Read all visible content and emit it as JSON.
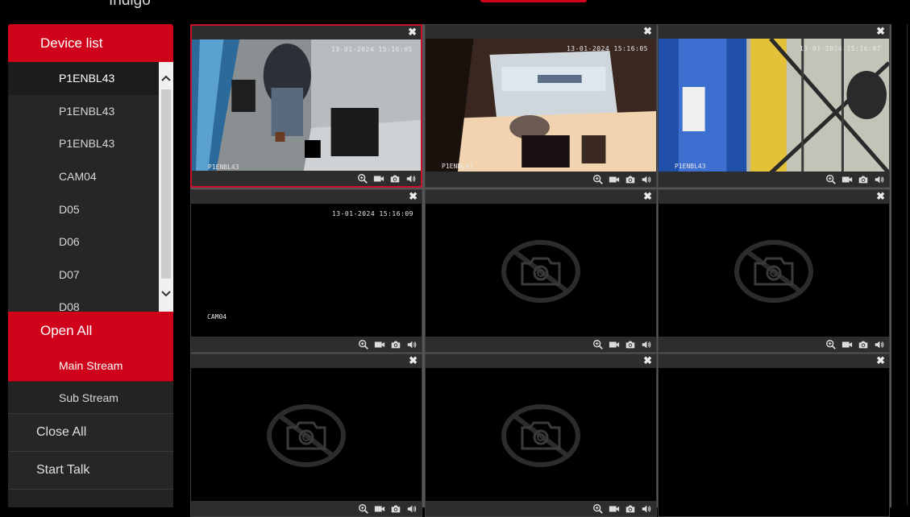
{
  "app": {
    "brand": "Indigo"
  },
  "sidebar": {
    "header": "Device list",
    "devices": [
      {
        "label": "P1ENBL43",
        "active": true
      },
      {
        "label": "P1ENBL43",
        "active": false
      },
      {
        "label": "P1ENBL43",
        "active": false
      },
      {
        "label": "CAM04",
        "active": false
      },
      {
        "label": "D05",
        "active": false
      },
      {
        "label": "D06",
        "active": false
      },
      {
        "label": "D07",
        "active": false
      },
      {
        "label": "D08",
        "active": false
      }
    ],
    "open_all": "Open All",
    "streams": [
      {
        "label": "Main Stream",
        "active": true
      },
      {
        "label": "Sub Stream",
        "active": false
      }
    ],
    "close_all": "Close All",
    "start_talk": "Start Talk"
  },
  "grid": {
    "close_symbol": "✖",
    "cells": [
      {
        "timestamp": "13-01-2024 15:16:05",
        "camera": "P1ENBL43",
        "state": "live",
        "selected": true
      },
      {
        "timestamp": "13-01-2024 15:16:05",
        "camera": "P1ENBL43",
        "state": "live",
        "selected": false
      },
      {
        "timestamp": "13-01-2024 15:16:07",
        "camera": "P1ENBL43",
        "state": "live",
        "selected": false
      },
      {
        "timestamp": "13-01-2024 15:16:09",
        "camera": "CAM04",
        "state": "live-dark",
        "selected": false
      },
      {
        "timestamp": "",
        "camera": "",
        "state": "no-signal",
        "selected": false
      },
      {
        "timestamp": "",
        "camera": "",
        "state": "no-signal",
        "selected": false
      },
      {
        "timestamp": "",
        "camera": "",
        "state": "no-signal",
        "selected": false
      },
      {
        "timestamp": "",
        "camera": "",
        "state": "no-signal",
        "selected": false
      },
      {
        "timestamp": "",
        "camera": "",
        "state": "empty",
        "selected": false
      }
    ],
    "controls": [
      "zoom-in-icon",
      "record-icon",
      "snapshot-icon",
      "audio-icon"
    ]
  },
  "colors": {
    "accent": "#d0021b",
    "sidebar_bg": "#232323",
    "grid_border": "#555555"
  }
}
